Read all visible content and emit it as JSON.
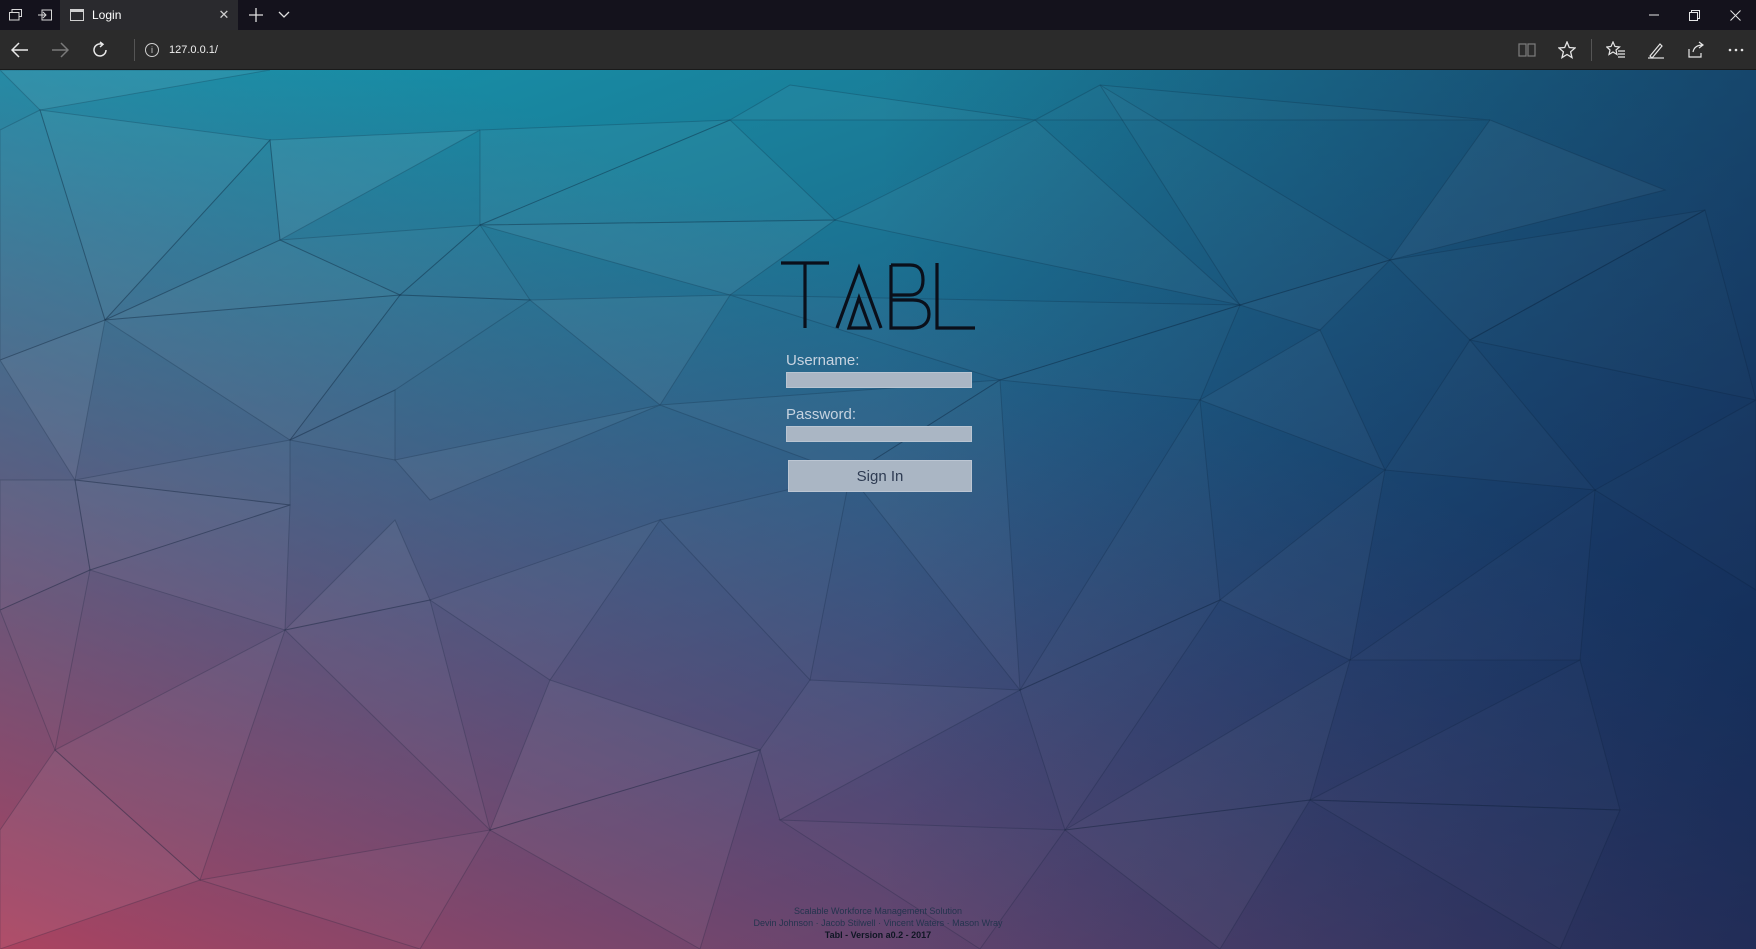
{
  "browser": {
    "tab": {
      "title": "Login"
    },
    "address": {
      "url": "127.0.0.1/"
    },
    "icons": {
      "tab_set_aside": "tabs-aside-icon",
      "tab_show_aside": "show-aside-icon",
      "tab_page": "page-icon",
      "tab_close": "close-icon",
      "new_tab": "plus-icon",
      "tab_menu": "chevron-down-icon",
      "back": "arrow-left-icon",
      "forward": "arrow-right-icon",
      "refresh": "refresh-icon",
      "site_info": "info-icon",
      "reading_view": "book-icon",
      "favorite": "star-icon",
      "favorites_hub": "favorites-icon",
      "web_note": "pen-icon",
      "share": "share-icon",
      "more": "more-icon",
      "minimize": "minimize-icon",
      "restore": "restore-icon",
      "close_window": "close-icon"
    }
  },
  "login": {
    "logo_text": "TABL",
    "username_label": "Username:",
    "password_label": "Password:",
    "signin_label": "Sign In"
  },
  "footer": {
    "tagline": "Scalable Workforce Management Solution",
    "authors": "Devin Johnson · Jacob Stilwell · Vincent Waters · Mason Wray",
    "version": "Tabl - Version a0.2 - 2017"
  },
  "colors": {
    "bg_top_left": "#1597ad",
    "bg_bottom_right": "#152f5e",
    "bg_bottom_left": "#a0405f",
    "input_fill": "#aab6c4"
  }
}
